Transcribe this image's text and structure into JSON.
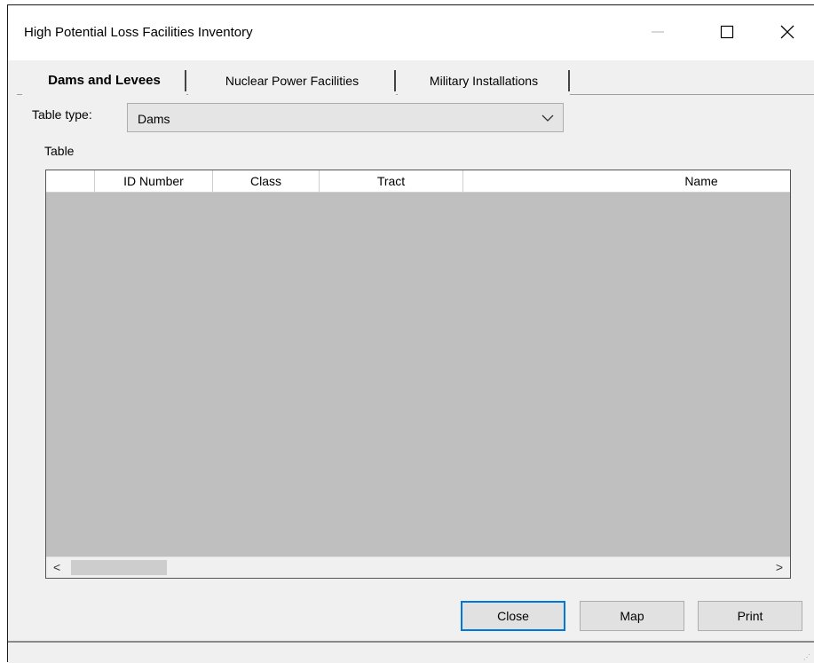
{
  "window": {
    "title": "High Potential Loss Facilities Inventory",
    "controls": [
      "minimize-icon",
      "maximize-icon",
      "close-icon"
    ]
  },
  "tabs": [
    {
      "label": "Dams and Levees",
      "active": true
    },
    {
      "label": "Nuclear Power Facilities",
      "active": false
    },
    {
      "label": "Military Installations",
      "active": false
    }
  ],
  "form": {
    "table_type_label": "Table type:",
    "table_type_value": "Dams",
    "table_label": "Table"
  },
  "grid": {
    "columns": [
      "",
      "ID Number",
      "Class",
      "Tract",
      "Name"
    ],
    "rows": [],
    "scroll_left": "<",
    "scroll_right": ">"
  },
  "buttons": {
    "close": "Close",
    "map": "Map",
    "print": "Print"
  },
  "colors": {
    "accent": "#0078d7",
    "grid_background": "#bfbfbf",
    "window_background": "#f0f0f0"
  }
}
